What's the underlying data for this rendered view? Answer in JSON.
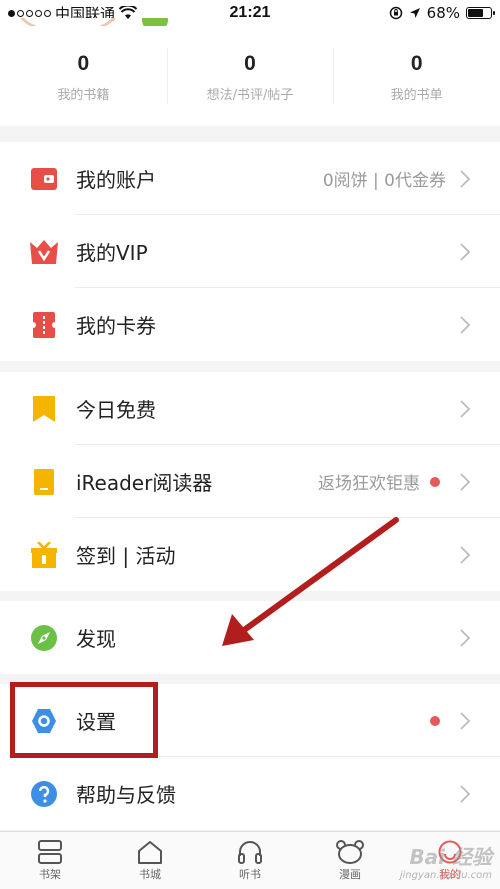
{
  "status_bar": {
    "carrier": "中国联通",
    "time": "21:21",
    "battery": "68%",
    "battery_level": 0.68
  },
  "stats": [
    {
      "value": "0",
      "label": "我的书籍"
    },
    {
      "value": "0",
      "label": "想法/书评/帖子"
    },
    {
      "value": "0",
      "label": "我的书单"
    }
  ],
  "sections": [
    {
      "items": [
        {
          "label": "我的账户",
          "value": "0阅饼 | 0代金券",
          "icon": "wallet-icon",
          "color": "#e84e48"
        },
        {
          "label": "我的VIP",
          "value": "",
          "icon": "vip-crown-icon",
          "color": "#e84e48"
        },
        {
          "label": "我的卡券",
          "value": "",
          "icon": "coupon-icon",
          "color": "#e84e48"
        }
      ]
    },
    {
      "items": [
        {
          "label": "今日免费",
          "value": "",
          "icon": "bookmark-icon",
          "color": "#f5b400"
        },
        {
          "label": "iReader阅读器",
          "value": "返场狂欢钜惠",
          "icon": "ereader-icon",
          "color": "#f5b400",
          "dot": true
        },
        {
          "label": "签到 | 活动",
          "value": "",
          "icon": "gift-icon",
          "color": "#f5b400"
        }
      ]
    },
    {
      "items": [
        {
          "label": "发现",
          "value": "",
          "icon": "compass-icon",
          "color": "#6cc046"
        }
      ]
    },
    {
      "items": [
        {
          "label": "设置",
          "value": "",
          "icon": "settings-hex-icon",
          "color": "#3d8fe6",
          "dot": true
        },
        {
          "label": "帮助与反馈",
          "value": "",
          "icon": "help-icon",
          "color": "#3d8fe6"
        }
      ]
    }
  ],
  "tabs": [
    {
      "label": "书架",
      "icon": "bookshelf-icon"
    },
    {
      "label": "书城",
      "icon": "home-icon"
    },
    {
      "label": "听书",
      "icon": "headphones-icon"
    },
    {
      "label": "漫画",
      "icon": "bear-icon"
    },
    {
      "label": "我的",
      "icon": "profile-icon",
      "active": true
    }
  ],
  "colors": {
    "accent": "#e45a5a",
    "annotation": "#b21e1e"
  },
  "watermark": {
    "main": "Bai 经验",
    "sub": "jingyan.baidu.com"
  }
}
